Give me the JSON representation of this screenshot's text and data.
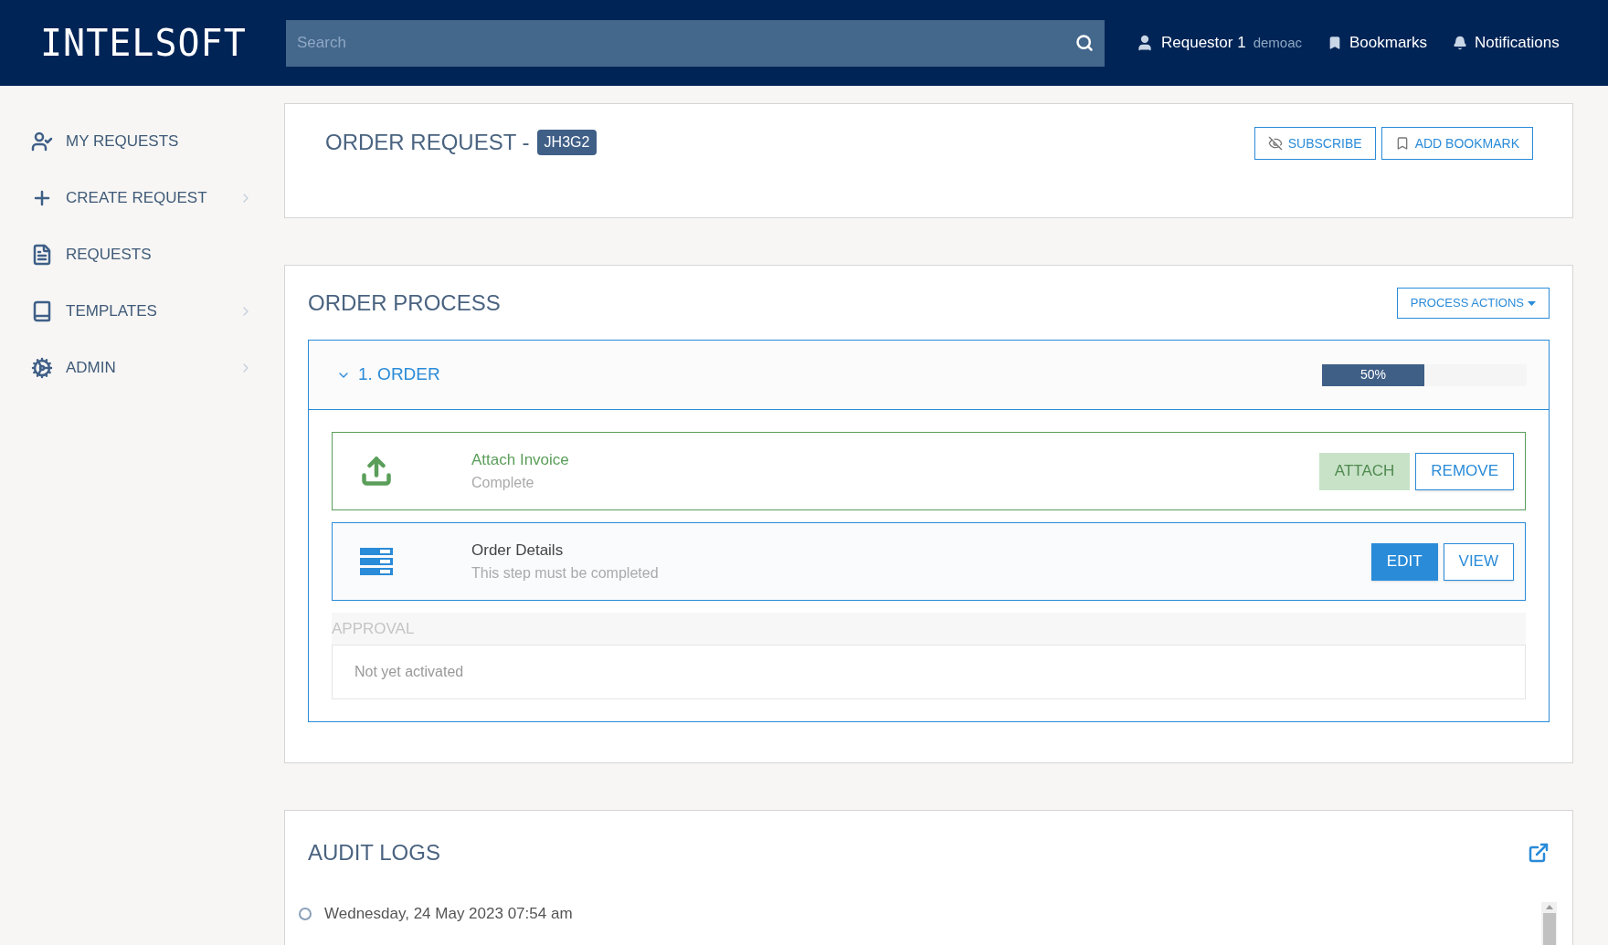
{
  "header": {
    "logo": "INTELSOFT",
    "search": {
      "placeholder": "Search"
    },
    "user": {
      "name": "Requestor 1",
      "account": "demoac"
    },
    "links": [
      {
        "kind": "bookmark",
        "label": "Bookmarks"
      },
      {
        "kind": "bell",
        "label": "Notifications"
      }
    ]
  },
  "sidebar": {
    "items": [
      {
        "kind": "user",
        "label": "MY REQUESTS",
        "has_submenu": false
      },
      {
        "kind": "plus",
        "label": "CREATE REQUEST",
        "has_submenu": true
      },
      {
        "kind": "file",
        "label": "REQUESTS",
        "has_submenu": false
      },
      {
        "kind": "book",
        "label": "TEMPLATES",
        "has_submenu": true
      },
      {
        "kind": "gears",
        "label": "ADMIN",
        "has_submenu": true
      }
    ]
  },
  "request": {
    "title": "ORDER REQUEST -",
    "code": "JH3G2",
    "actions": [
      {
        "kind": "eye",
        "label": "SUBSCRIBE"
      },
      {
        "kind": "bookmark",
        "label": "ADD BOOKMARK"
      }
    ]
  },
  "process": {
    "title": "ORDER PROCESS",
    "actions_button": "PROCESS ACTIONS",
    "phase": {
      "title": "1. ORDER",
      "expanded": true,
      "level": 0.5,
      "reading": "50%",
      "steps": [
        {
          "kind": "upload",
          "title": "Attach Invoice",
          "status": "Complete",
          "complete": true,
          "buttons": [
            {
              "label": "ATTACH",
              "disabled": true
            },
            {
              "label": "REMOVE",
              "disabled": false,
              "primary": false
            }
          ]
        },
        {
          "kind": "form",
          "title": "Order Details",
          "status": "This step must be completed",
          "complete": false,
          "buttons": [
            {
              "label": "EDIT",
              "disabled": false,
              "primary": true
            },
            {
              "label": "VIEW",
              "disabled": false,
              "primary": false
            }
          ]
        }
      ],
      "next": {
        "title": "APPROVAL",
        "message": "Not yet activated"
      }
    }
  },
  "audit": {
    "title": "AUDIT LOGS",
    "entries": [
      {
        "date": "Wednesday, 24 May 2023 07:54 am"
      }
    ]
  }
}
